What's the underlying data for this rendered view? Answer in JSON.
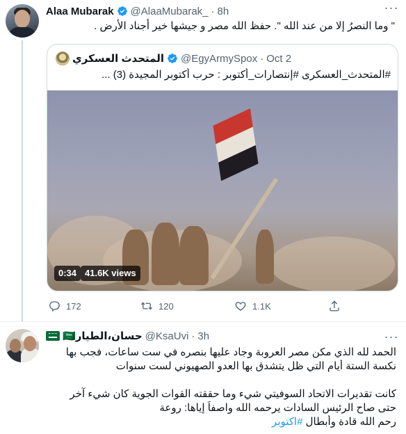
{
  "tweet1": {
    "author_name": "Alaa Mubarak",
    "handle": "@AlaaMubarak_",
    "dot": "·",
    "time": "8h",
    "more": "···",
    "text": "\" وما النصرُ إلا من عند الله \".      حفظ الله مصر و جيشها خير أجناد الأرض .",
    "quote": {
      "author_name": "المتحدث العسكري",
      "handle": "@EgyArmySpox",
      "dot": "·",
      "date": "Oct 2",
      "text": "#المتحدث_العسكرى #إنتصارات_أكتوبر : حرب أكتوبر المجيدة (3) ...",
      "video_time": "0:34",
      "views": "41.6K views"
    },
    "actions": {
      "replies": "172",
      "retweets": "120",
      "likes": "1.1K"
    }
  },
  "tweet2": {
    "author_name": "حسان،الطيار🇸🇦",
    "handle": "@KsaUvi",
    "dot": "·",
    "time": "3h",
    "more": "···",
    "lines": [
      "الحمد لله الذي مكن مصر العروبة وجاد عليها بنصره في ست ساعات، فجب بها",
      "نكسة الستة أيام التي ظل يتشدق بها العدو الصهيوني لست سنوات",
      "",
      "كانت تقديرات الاتحاد السوفيتي شيء وما حققته القوات الجوية كان شيء آخر",
      "حتى صاح الرئيس السادات يرحمه الله واصفاً إياها: روعة"
    ],
    "last_line_text": "رحم الله قادة وأبطال",
    "hashtag": "#اكتوبر"
  },
  "colors": {
    "accent": "#1d9bf0",
    "secondary_text": "#536471",
    "border": "#cfd9de"
  }
}
